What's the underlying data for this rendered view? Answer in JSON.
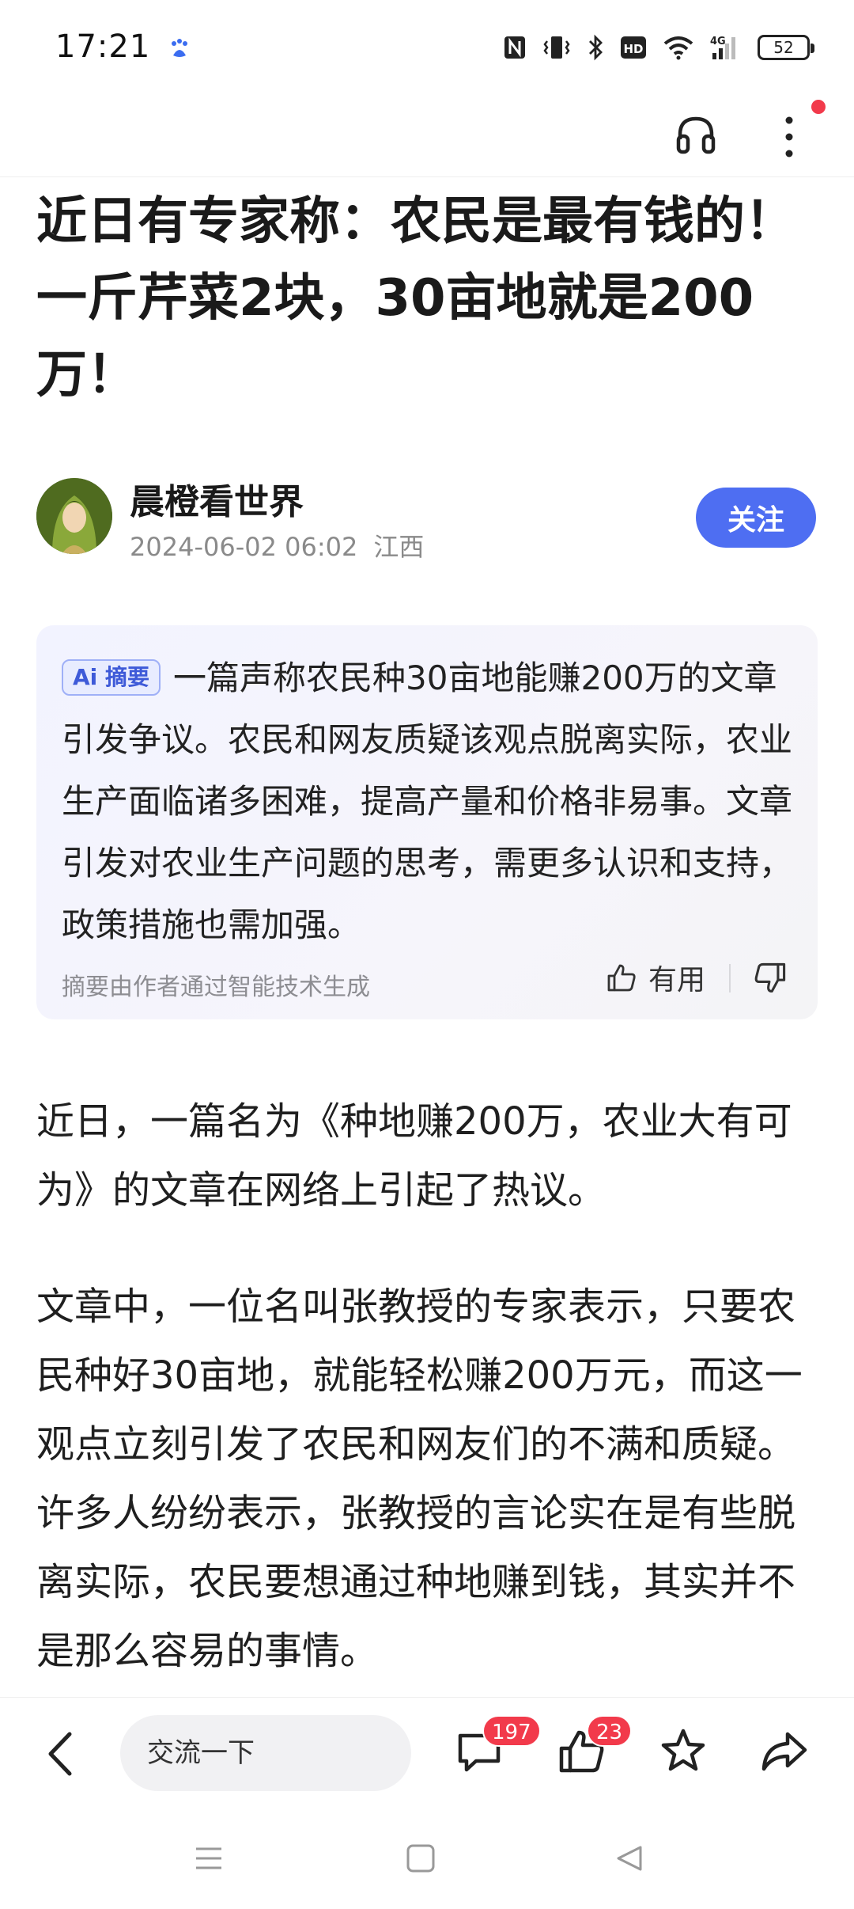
{
  "status_bar": {
    "time": "17:21",
    "battery": "52",
    "icons": [
      "baidu-paw-icon",
      "nfc-icon",
      "vibrate-icon",
      "bluetooth-icon",
      "hd-icon",
      "wifi-icon",
      "signal-4g-icon",
      "battery-icon"
    ]
  },
  "top_bar": {
    "icons": [
      "headphones-icon",
      "more-icon"
    ],
    "notification_dot_color": "#f23a4b"
  },
  "article": {
    "title": "近日有专家称：农民是最有钱的！一斤芹菜2块，30亩地就是200万！",
    "author": {
      "name": "晨橙看世界",
      "datetime": "2024-06-02 06:02",
      "location": "江西",
      "follow_label": "关注"
    },
    "summary": {
      "badge": "Ai 摘要",
      "text": "一篇声称农民种30亩地能赚200万的文章引发争议。农民和网友质疑该观点脱离实际，农业生产面临诸多困难，提高产量和价格非易事。文章引发对农业生产问题的思考，需更多认识和支持，政策措施也需加强。",
      "note": "摘要由作者通过智能技术生成",
      "useful_label": "有用"
    },
    "paragraphs": [
      "近日，一篇名为《种地赚200万，农业大有可为》的文章在网络上引起了热议。",
      "文章中，一位名叫张教授的专家表示，只要农民种好30亩地，就能轻松赚200万元，而这一观点立刻引发了农民和网友们的不满和质疑。许多人纷纷表示，张教授的言论实在是有些脱离实际，农民要想通过种地赚到钱，其实并不是那么容易的事情。"
    ]
  },
  "bottom_bar": {
    "comment_placeholder": "交流一下",
    "comment_count": "197",
    "like_count": "23"
  },
  "colors": {
    "accent": "#4e6ef2",
    "badge_red": "#f23a4b"
  }
}
